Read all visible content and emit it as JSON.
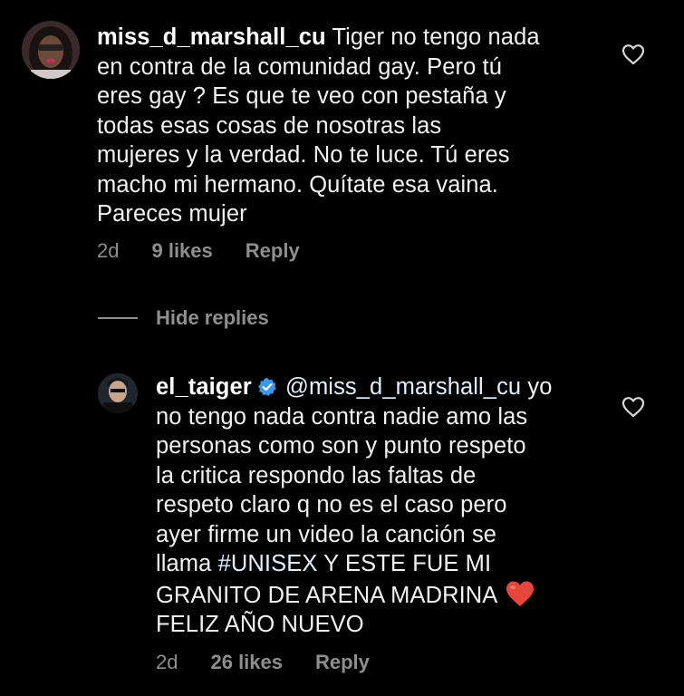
{
  "comments": [
    {
      "username": "miss_d_marshall_cu",
      "lines": [
        "Tiger no tengo nada",
        "en contra de la comunidad gay. Pero tú",
        "eres gay ? Es que te veo con pestaña y",
        "todas esas cosas de nosotras las",
        "mujeres y la verdad. No te luce. Tú eres",
        "macho mi hermano. Quítate esa vaina.",
        "Pareces mujer"
      ],
      "time": "2d",
      "likes": "9 likes",
      "reply_label": "Reply"
    },
    {
      "username": "el_taiger",
      "mention": "@miss_d_marshall_cu",
      "first_line_tail": "yo",
      "lines": [
        "no tengo nada contra nadie amo las",
        "personas como son y punto respeto",
        "la critica respondo las faltas  de",
        "respeto claro q no es el caso pero",
        "ayer firme un video la canción se"
      ],
      "line7_prefix": "llama",
      "hashtag": "#UNISEX",
      "line7_suffix": " Y ESTE FUE MI",
      "line8": "GRANITO DE ARENA MADRINA",
      "line9": "FELIZ AÑO NUEVO",
      "time": "2d",
      "likes": "26 likes",
      "reply_label": "Reply"
    }
  ],
  "hide_replies_label": "Hide replies",
  "colors": {
    "background": "#000000",
    "text": "#f2f2f2",
    "muted": "#8e8e8e",
    "mention": "#e0f1ff",
    "verified": "#3897f0",
    "heart_emoji": "#e8453c"
  },
  "icons": [
    "heart-outline-icon",
    "verified-badge-icon",
    "red-heart-emoji"
  ]
}
